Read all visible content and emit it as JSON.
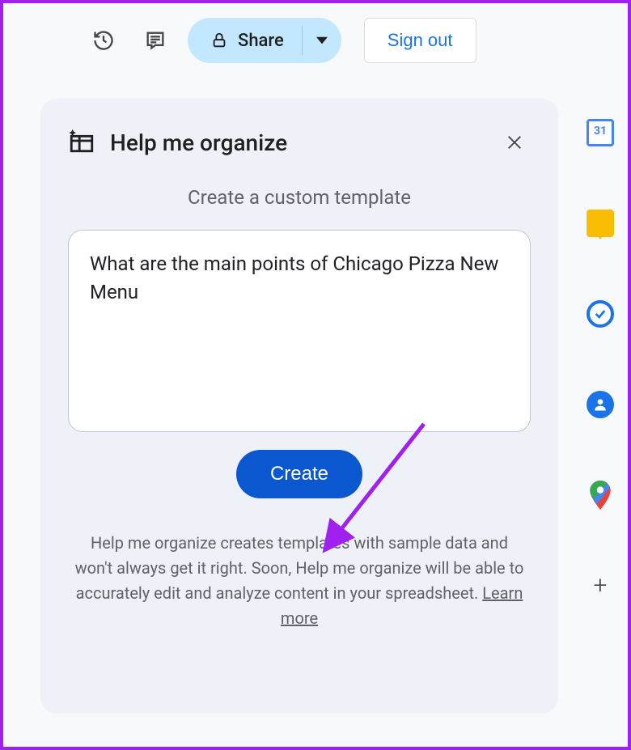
{
  "toolbar": {
    "share_label": "Share",
    "signout_label": "Sign out"
  },
  "sidepanel": {
    "calendar_day": "31"
  },
  "panel": {
    "title": "Help me organize",
    "subtitle": "Create a custom template",
    "prompt_text": "What are the main points of Chicago Pizza New Menu",
    "create_label": "Create",
    "disclaimer_prefix": "Help me organize creates templates with sample data and won't always get it right. Soon, Help me organize will be able to accurately edit and analyze content in your spreadsheet. ",
    "learn_more": "Learn more"
  }
}
